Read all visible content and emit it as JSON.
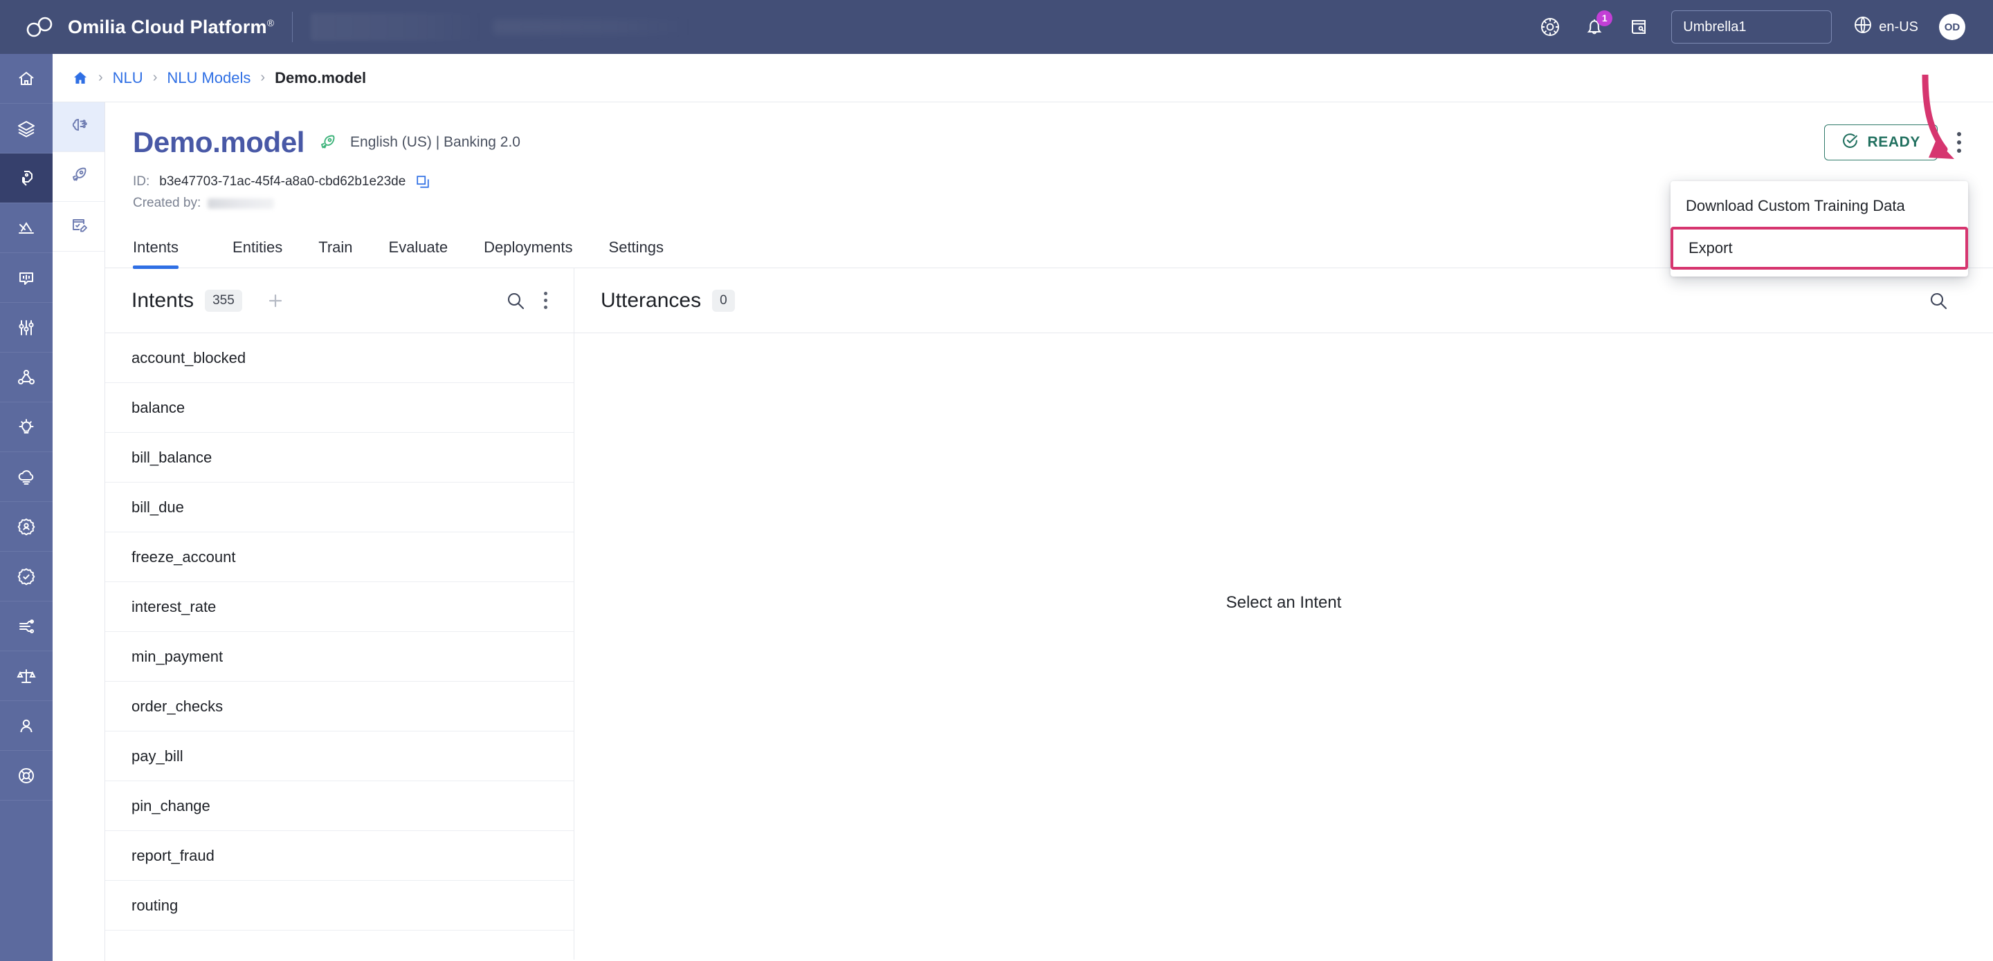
{
  "topbar": {
    "brand": "Omilia Cloud Platform",
    "brand_mark": "®",
    "notification_count": "1",
    "tenant": "Umbrella1",
    "locale": "en-US",
    "avatar_initials": "OD",
    "icons": [
      "settings-wheel-icon",
      "bell-icon",
      "notes-icon",
      "globe-icon"
    ]
  },
  "breadcrumb": {
    "home": "home-icon",
    "items": [
      "NLU",
      "NLU Models"
    ],
    "current": "Demo.model",
    "separator": "›"
  },
  "page": {
    "title": "Demo.model",
    "language_and_domain": "English (US) | Banking 2.0",
    "id_label": "ID:",
    "id_value": "b3e47703-71ac-45f4-a8a0-cbd62b1e23de",
    "created_by_label": "Created by:",
    "created_by_value": "",
    "status_label": "READY"
  },
  "tabs": [
    {
      "label": "Intents",
      "active": true
    },
    {
      "label": "Entities",
      "active": false
    },
    {
      "label": "Train",
      "active": false
    },
    {
      "label": "Evaluate",
      "active": false
    },
    {
      "label": "Deployments",
      "active": false
    },
    {
      "label": "Settings",
      "active": false
    }
  ],
  "intents_panel": {
    "title": "Intents",
    "count": "355",
    "items": [
      "account_blocked",
      "balance",
      "bill_balance",
      "bill_due",
      "freeze_account",
      "interest_rate",
      "min_payment",
      "order_checks",
      "pay_bill",
      "pin_change",
      "report_fraud",
      "routing"
    ]
  },
  "utterances_panel": {
    "title": "Utterances",
    "count": "0",
    "empty_message": "Select an Intent"
  },
  "context_menu": {
    "items": [
      {
        "label": "Download Custom Training Data",
        "highlighted": false
      },
      {
        "label": "Export",
        "highlighted": true
      }
    ]
  },
  "colors": {
    "topbar": "#434f77",
    "rail": "#5c6a9e",
    "accent_blue": "#2f6fe4",
    "title_blue": "#4858a6",
    "ready_green": "#21705f",
    "annotation_pink": "#d6356f",
    "badge_purple": "#c33fd6"
  }
}
